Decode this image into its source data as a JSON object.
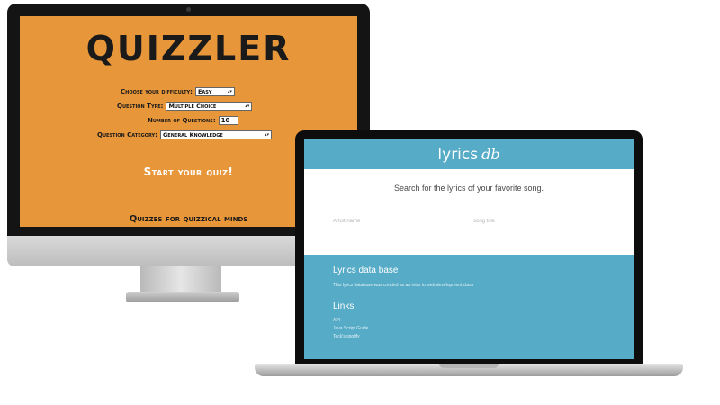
{
  "quizzler": {
    "title": "QUIZZLER",
    "difficulty": {
      "label": "Choose your difficulty:",
      "value": "Easy"
    },
    "question_type": {
      "label": "Question Type:",
      "value": "Multiple Choice"
    },
    "num_questions": {
      "label": "Number of Questions:",
      "value": "10"
    },
    "category": {
      "label": "Question Category:",
      "value": "General Knowledge"
    },
    "start_button": "Start your quiz!",
    "tagline": "Quizzes for quizzical minds",
    "colors": {
      "background": "#e8963a",
      "text": "#1a1a1a",
      "button_text": "#ffffff"
    }
  },
  "lyrics": {
    "logo_main": "lyrics",
    "logo_accent": "db",
    "search_title": "Search for the lyrics of your favorite song.",
    "artist_placeholder": "Artist name",
    "song_placeholder": "song title",
    "footer": {
      "heading": "Lyrics data base",
      "description": "This lyrics database was created as an intro to web development class",
      "links_heading": "Links",
      "links": [
        "API",
        "Java Script Guide",
        "Teck's spotify"
      ]
    },
    "colors": {
      "accent": "#56abc6",
      "background": "#ffffff"
    }
  }
}
